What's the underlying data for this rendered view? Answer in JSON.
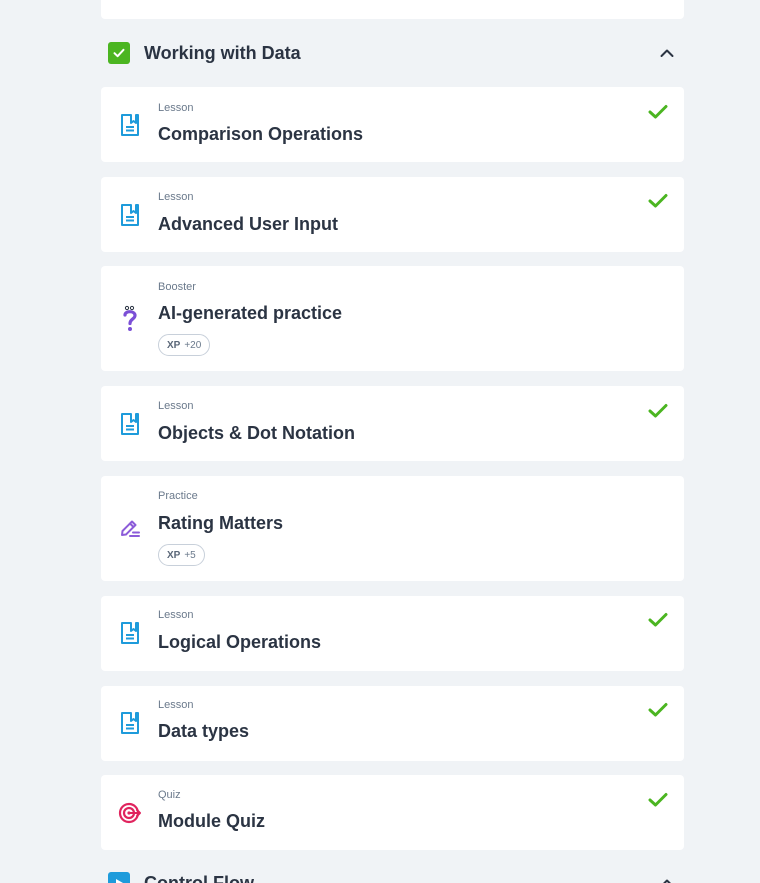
{
  "modules": [
    {
      "title": "Working with Data",
      "status": "completed",
      "expanded": true
    },
    {
      "title": "Control Flow",
      "status": "in-progress",
      "expanded": true
    }
  ],
  "items": [
    {
      "type": "Lesson",
      "title": "Comparison Operations",
      "icon": "lesson-icon",
      "completed": true
    },
    {
      "type": "Lesson",
      "title": "Advanced User Input",
      "icon": "lesson-icon",
      "completed": true
    },
    {
      "type": "Booster",
      "title": "AI-generated practice",
      "icon": "booster-icon",
      "completed": false,
      "xp_label": "XP",
      "xp_value": "+20"
    },
    {
      "type": "Lesson",
      "title": "Objects & Dot Notation",
      "icon": "lesson-icon",
      "completed": true
    },
    {
      "type": "Practice",
      "title": "Rating Matters",
      "icon": "practice-icon",
      "completed": false,
      "xp_label": "XP",
      "xp_value": "+5"
    },
    {
      "type": "Lesson",
      "title": "Logical Operations",
      "icon": "lesson-icon",
      "completed": true
    },
    {
      "type": "Lesson",
      "title": "Data types",
      "icon": "lesson-icon",
      "completed": true
    },
    {
      "type": "Quiz",
      "title": "Module Quiz",
      "icon": "quiz-icon",
      "completed": true
    }
  ],
  "colors": {
    "background": "#f0f3f6",
    "card": "#ffffff",
    "success_green": "#4bb521",
    "lesson_blue": "#1e9bdb",
    "booster_purple": "#7b4fd6",
    "practice_purple": "#8c5cd9",
    "quiz_pink": "#e0245e",
    "control_flow_blue": "#1e9bdb"
  }
}
